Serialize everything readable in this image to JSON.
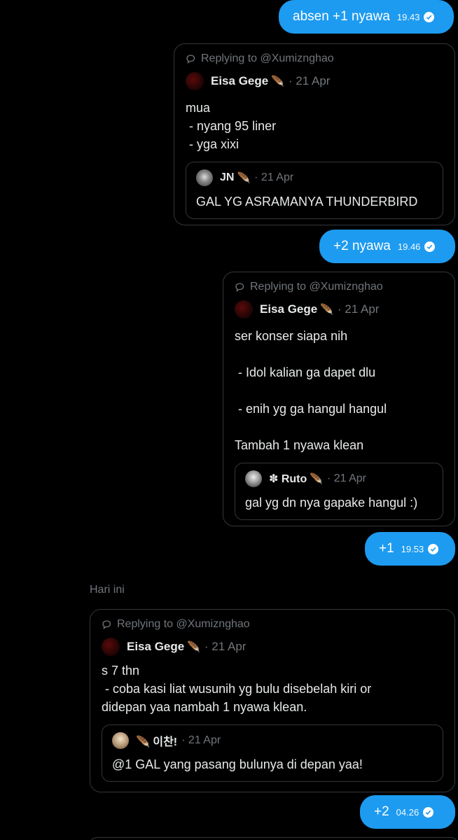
{
  "messages": {
    "m1": {
      "text": "absen +1 nyawa",
      "time": "19.43"
    },
    "m2": {
      "text": "+2 nyawa",
      "time": "19.46"
    },
    "m3": {
      "text": "+1",
      "time": "19.53"
    },
    "m4": {
      "text": "+2",
      "time": "04.26"
    }
  },
  "day_separator": "Hari ini",
  "cards": {
    "c1": {
      "replying": "Replying to @Xumiznghao",
      "author": "Eisa Gege",
      "author_emoji": "🪶",
      "date": "· 21 Apr",
      "text": "mua\n - nyang 95 liner\n - yga xixi",
      "quote": {
        "author": "JN",
        "author_emoji": "🪶",
        "date": "· 21 Apr",
        "text": "GAL YG ASRAMANYA THUNDERBIRD"
      }
    },
    "c2": {
      "replying": "Replying to @Xumiznghao",
      "author": "Eisa Gege",
      "author_emoji": "🪶",
      "date": "· 21 Apr",
      "text": "ser konser siapa nih\n\n - Idol kalian ga dapet dlu\n\n - enih yg ga hangul hangul\n\nTambah 1 nyawa klean",
      "quote": {
        "author": "✽ Ruto",
        "author_emoji": "🪶",
        "date": "· 21 Apr",
        "text": "gal yg dn nya gapake hangul :)"
      }
    },
    "c3": {
      "replying": "Replying to @Xumiznghao",
      "author": "Eisa Gege",
      "author_emoji": "🪶",
      "date": "· 21 Apr",
      "text": "s 7 thn\n - coba kasi liat wusunih yg bulu disebelah kiri or\ndidepan yaa nambah 1 nyawa klean.",
      "quote": {
        "author": "🪶 이찬!",
        "author_emoji": "",
        "date": "· 21 Apr",
        "text": "@1 GAL yang pasang bulunya di depan yaa!"
      }
    }
  },
  "icons": {
    "reply": "reply-icon",
    "read": "check-circle-icon"
  },
  "colors": {
    "bubble": "#1d9bf0",
    "border": "#333639",
    "muted": "#71767b",
    "text": "#e7e9ea"
  }
}
